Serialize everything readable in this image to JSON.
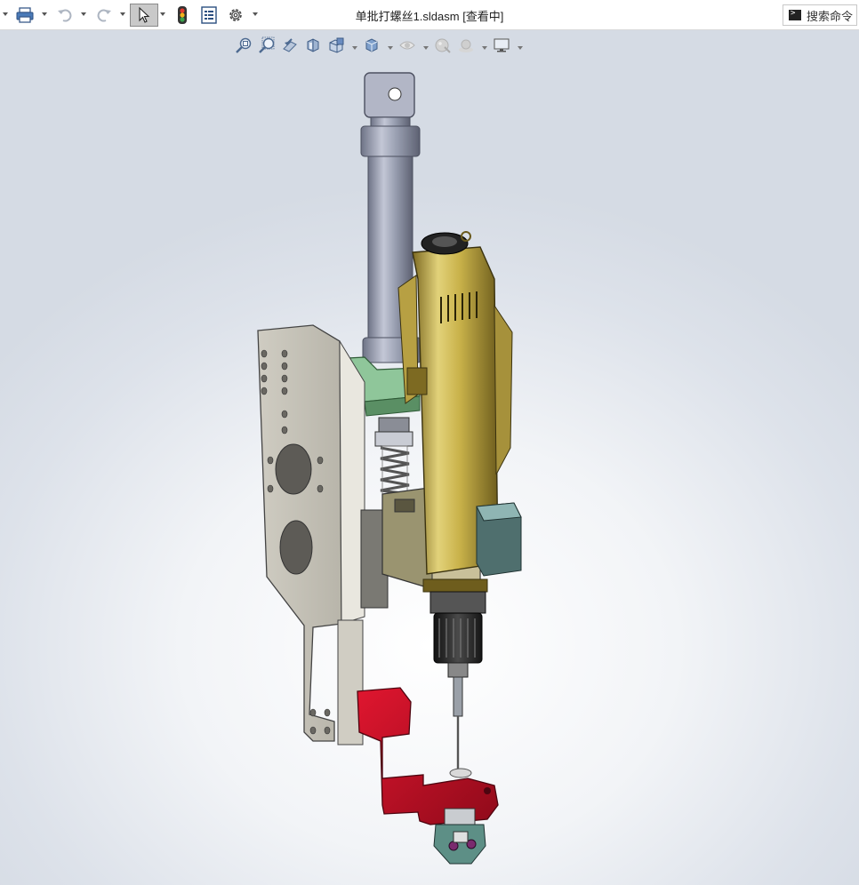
{
  "window": {
    "title": "单批打螺丝1.sldasm [查看中]"
  },
  "toolbar": {
    "items": [
      "print-icon",
      "undo-icon",
      "redo-icon",
      "select-icon",
      "traffic-light-icon",
      "file-properties-icon",
      "options-gear-icon"
    ]
  },
  "search": {
    "label": "搜索命令"
  },
  "view_toolbar": {
    "items": [
      "zoom-to-fit-icon",
      "zoom-to-area-icon",
      "previous-view-icon",
      "section-view-icon",
      "view-orientation-icon",
      "display-style-icon",
      "hide-show-items-icon",
      "edit-appearance-icon",
      "apply-scene-icon",
      "view-settings-icon"
    ]
  },
  "colors": {
    "accent_select": "#c9c9c9",
    "part_red": "#c8102e",
    "part_gold": "#c9b24a",
    "part_plate": "#d8d5cc",
    "part_cylinder": "#8f93a3",
    "part_green": "#8fc69a",
    "part_khaki": "#9a9470",
    "part_teal": "#4f6f6e"
  }
}
